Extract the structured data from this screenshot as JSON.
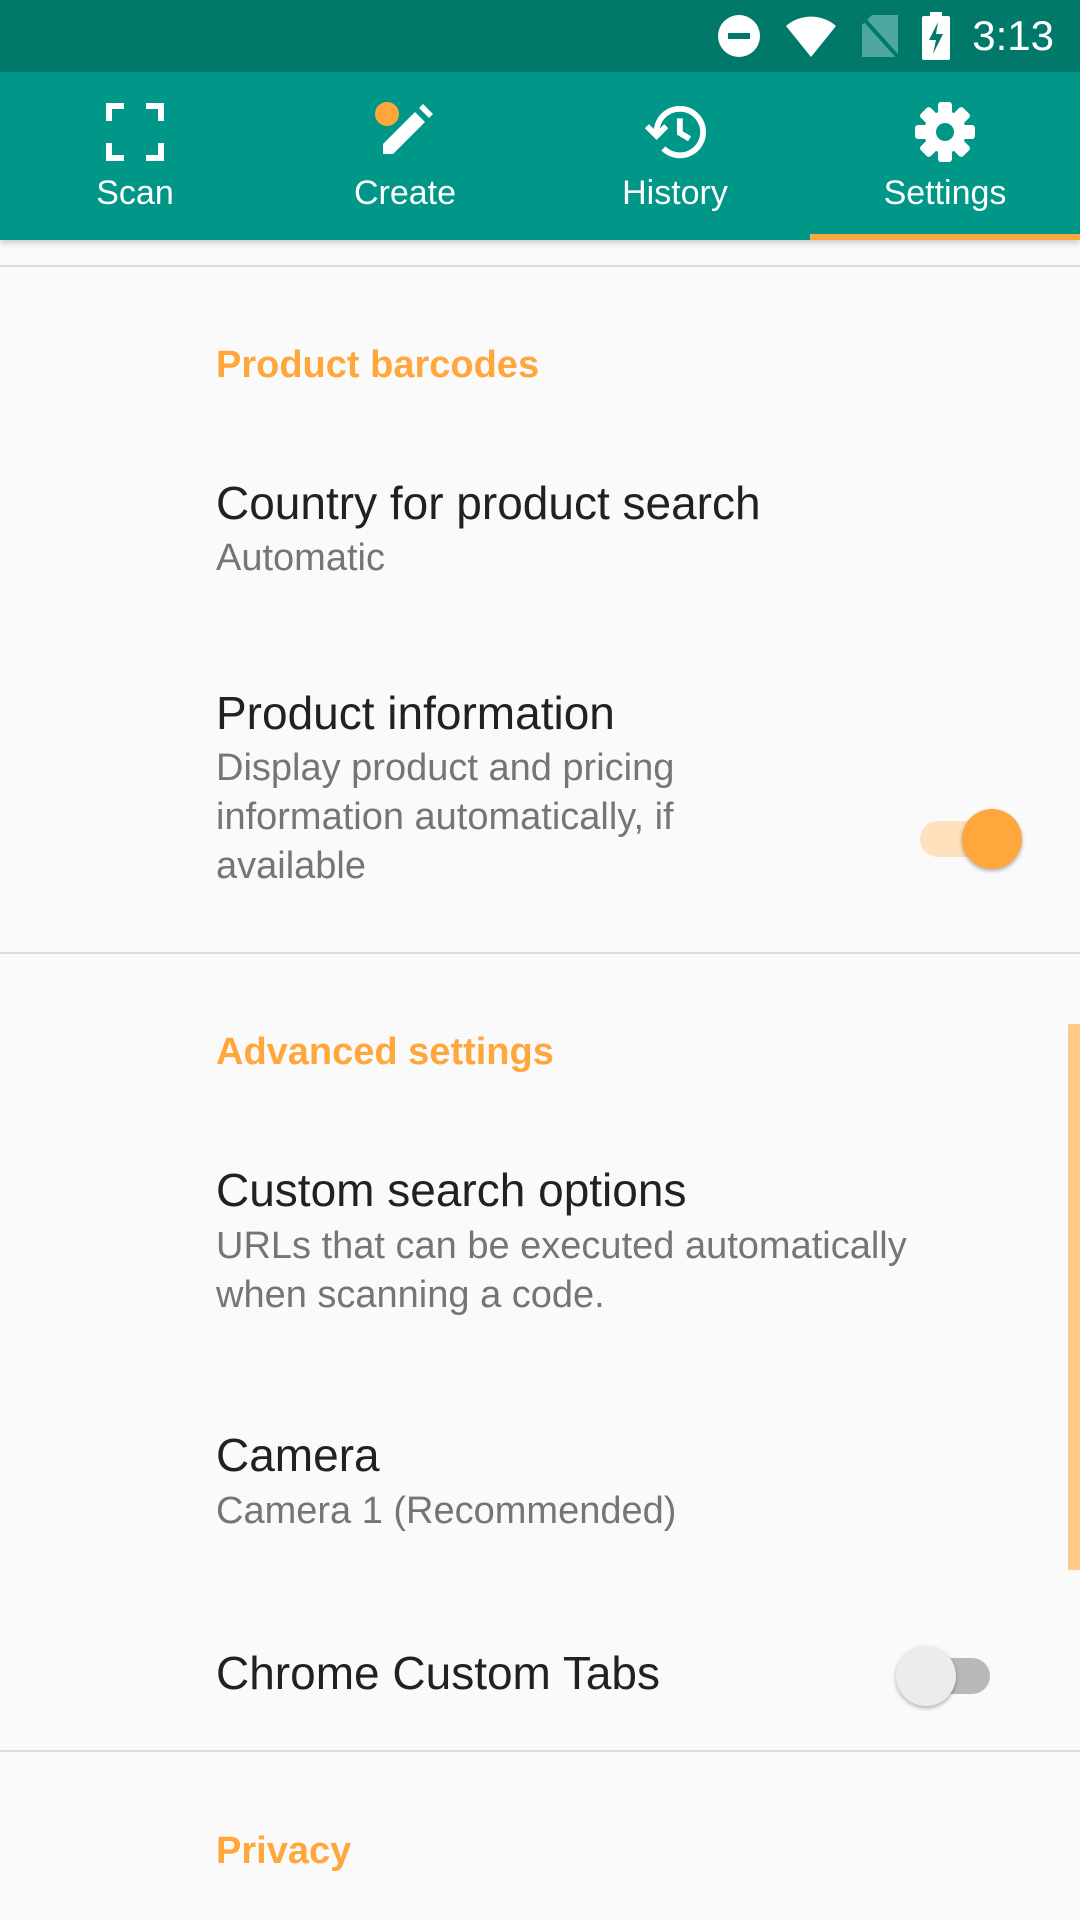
{
  "status_bar": {
    "time": "3:13",
    "icons": [
      "do-not-disturb-icon",
      "wifi-icon",
      "no-sim-icon",
      "battery-charging-icon"
    ]
  },
  "tabs": [
    {
      "label": "Scan",
      "icon": "scan-icon"
    },
    {
      "label": "Create",
      "icon": "pencil-icon"
    },
    {
      "label": "History",
      "icon": "history-icon"
    },
    {
      "label": "Settings",
      "icon": "gear-icon",
      "active": true
    }
  ],
  "sections": {
    "product_barcodes": {
      "header": "Product barcodes",
      "country": {
        "title": "Country for product search",
        "summary": "Automatic"
      },
      "product_info": {
        "title": "Product information",
        "summary_lines": [
          "Display product and pricing",
          "information automatically, if",
          "available"
        ],
        "enabled": true
      }
    },
    "advanced": {
      "header": "Advanced settings",
      "custom_search": {
        "title": "Custom search options",
        "summary_lines": [
          "URLs that can be executed automatically",
          "when scanning a code."
        ]
      },
      "camera": {
        "title": "Camera",
        "summary": "Camera 1 (Recommended)"
      },
      "chrome_tabs": {
        "title": "Chrome Custom Tabs",
        "enabled": false
      }
    },
    "privacy": {
      "header": "Privacy"
    }
  },
  "colors": {
    "status_bar": "#00796b",
    "toolbar": "#009688",
    "accent": "#ffa73c",
    "background": "#fafafa"
  }
}
